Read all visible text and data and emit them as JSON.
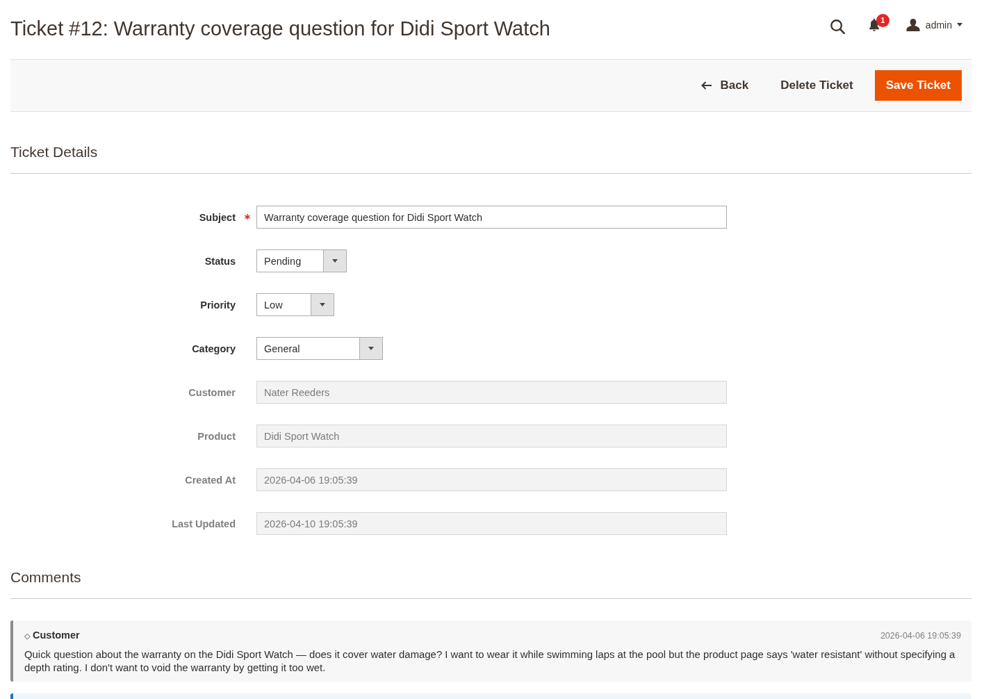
{
  "page": {
    "title": "Ticket #12: Warranty coverage question for Didi Sport Watch"
  },
  "header": {
    "notifications": {
      "count": "1"
    },
    "user": {
      "name": "admin"
    }
  },
  "actions": [
    {
      "label": "Back",
      "kind": "back"
    },
    {
      "label": "Delete Ticket",
      "kind": "plain"
    },
    {
      "label": "Save Ticket",
      "kind": "primary"
    }
  ],
  "details": {
    "title": "Ticket Details",
    "fields": [
      {
        "label": "Subject",
        "kind": "text",
        "required": true,
        "disabled": false,
        "value": "Warranty coverage question for Didi Sport Watch"
      },
      {
        "label": "Status",
        "kind": "select",
        "required": false,
        "disabled": false,
        "value": "Pending"
      },
      {
        "label": "Priority",
        "kind": "select",
        "required": false,
        "disabled": false,
        "value": "Low"
      },
      {
        "label": "Category",
        "kind": "select",
        "required": false,
        "disabled": false,
        "value": "General"
      },
      {
        "label": "Customer",
        "kind": "text",
        "required": false,
        "disabled": true,
        "value": "Nater Reeders"
      },
      {
        "label": "Product",
        "kind": "text",
        "required": false,
        "disabled": true,
        "value": "Didi Sport Watch"
      },
      {
        "label": "Created At",
        "kind": "text",
        "required": false,
        "disabled": true,
        "value": "2026-04-06 19:05:39"
      },
      {
        "label": "Last Updated",
        "kind": "text",
        "required": false,
        "disabled": true,
        "value": "2026-04-10 19:05:39"
      }
    ]
  },
  "comments": {
    "title": "Comments",
    "items": [
      {
        "color": "#8c8c8c",
        "marker": "◇",
        "author": "Customer",
        "time": "2026-04-06 19:05:39",
        "text": "Quick question about the warranty on the Didi Sport Watch — does it cover water damage? I want to wear it while swimming laps at the pool but the product page says 'water resistant' without specifying a depth rating. I don't want to void the warranty by getting it too wet."
      },
      {
        "color": "#1979c3"
      }
    ]
  }
}
